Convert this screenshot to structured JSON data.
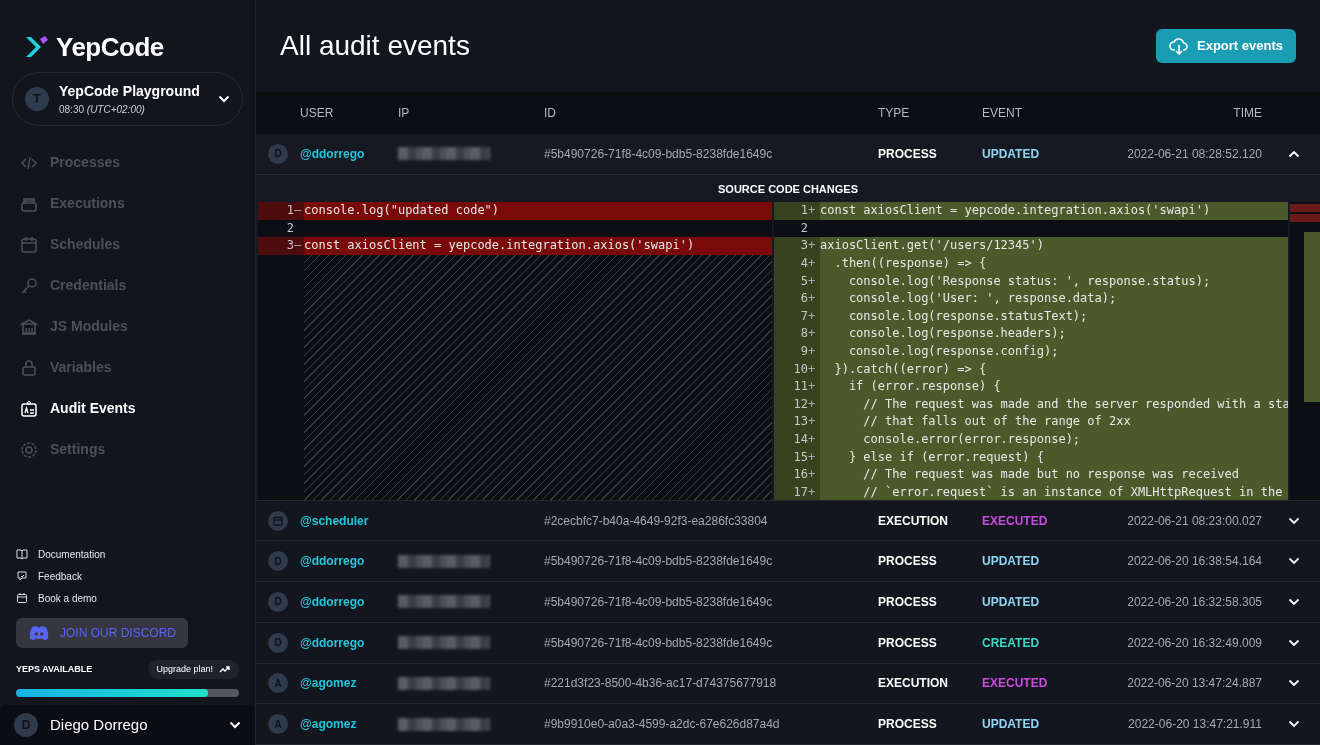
{
  "brand": {
    "name": "YepCode"
  },
  "workspace": {
    "avatar": "T",
    "name": "YepCode Playground",
    "time": "08:30",
    "timezone": "(UTC+02:00)"
  },
  "nav": [
    {
      "label": "Processes",
      "selected": false
    },
    {
      "label": "Executions",
      "selected": false
    },
    {
      "label": "Schedules",
      "selected": false
    },
    {
      "label": "Credentials",
      "selected": false
    },
    {
      "label": "JS Modules",
      "selected": false
    },
    {
      "label": "Variables",
      "selected": false
    },
    {
      "label": "Audit Events",
      "selected": true
    },
    {
      "label": "Settings",
      "selected": false
    }
  ],
  "links": [
    {
      "label": "Documentation"
    },
    {
      "label": "Feedback"
    },
    {
      "label": "Book a demo"
    }
  ],
  "discord": {
    "label": "JOIN OUR DISCORD"
  },
  "yeps": {
    "label": "YEPS AVAILABLE",
    "upgrade": "Upgrade plan!",
    "level": 0.86
  },
  "user": {
    "avatar": "D",
    "name": "Diego Dorrego"
  },
  "page": {
    "title": "All audit events",
    "export_button": "Export events"
  },
  "table": {
    "columns": [
      "USER",
      "IP",
      "ID",
      "TYPE",
      "EVENT",
      "TIME"
    ],
    "rows": [
      {
        "avatar": "D",
        "user": "@ddorrego",
        "ip_redacted": true,
        "id": "#5b490726-71f8-4c09-bdb5-8238fde1649c",
        "type": "PROCESS",
        "event": "UPDATED",
        "color": "#8fd6f5",
        "time": "2022-06-21 08:28:52.120",
        "expanded": true
      },
      {
        "user": "@scheduler",
        "ip_redacted": false,
        "id": "#2cecbfc7-b40a-4649-92f3-ea286fc33804",
        "type": "EXECUTION",
        "event": "EXECUTED",
        "color": "#c94ce0",
        "time": "2022-06-21 08:23:00.027",
        "expanded": false
      },
      {
        "avatar": "D",
        "user": "@ddorrego",
        "ip_redacted": true,
        "id": "#5b490726-71f8-4c09-bdb5-8238fde1649c",
        "type": "PROCESS",
        "event": "UPDATED",
        "color": "#8fd6f5",
        "time": "2022-06-20 16:38:54.164",
        "expanded": false
      },
      {
        "avatar": "D",
        "user": "@ddorrego",
        "ip_redacted": true,
        "id": "#5b490726-71f8-4c09-bdb5-8238fde1649c",
        "type": "PROCESS",
        "event": "UPDATED",
        "color": "#8fd6f5",
        "time": "2022-06-20 16:32:58.305",
        "expanded": false
      },
      {
        "avatar": "D",
        "user": "@ddorrego",
        "ip_redacted": true,
        "id": "#5b490726-71f8-4c09-bdb5-8238fde1649c",
        "type": "PROCESS",
        "event": "CREATED",
        "color": "#3dd6c0",
        "time": "2022-06-20 16:32:49.009",
        "expanded": false
      },
      {
        "avatar": "A",
        "user": "@agomez",
        "ip_redacted": true,
        "id": "#221d3f23-8500-4b36-ac17-d74375677918",
        "type": "EXECUTION",
        "event": "EXECUTED",
        "color": "#c94ce0",
        "time": "2022-06-20 13:47:24.887",
        "expanded": false
      },
      {
        "avatar": "A",
        "user": "@agomez",
        "ip_redacted": true,
        "id": "#9b9910e0-a0a3-4599-a2dc-67e626d87a4d",
        "type": "PROCESS",
        "event": "UPDATED",
        "color": "#8fd6f5",
        "time": "2022-06-20 13:47:21.911",
        "expanded": false
      }
    ]
  },
  "diff": {
    "title": "SOURCE CODE CHANGES",
    "left": [
      {
        "kind": "removed",
        "number": "1",
        "marker": "—",
        "code": "console.log(\"updated code\")"
      },
      {
        "kind": "context",
        "number": "2"
      },
      {
        "kind": "removed",
        "number": "3",
        "marker": "—",
        "code": "const axiosClient = yepcode.integration.axios('swapi')"
      }
    ],
    "right": [
      {
        "kind": "added",
        "number": "1",
        "marker": "+",
        "code": "const axiosClient = yepcode.integration.axios('swapi')"
      },
      {
        "kind": "context",
        "number": "2"
      },
      {
        "kind": "added",
        "number": "3",
        "marker": "+",
        "code": "axiosClient.get('/users/12345')"
      },
      {
        "kind": "added",
        "number": "4",
        "marker": "+",
        "code": "  .then((response) => {"
      },
      {
        "kind": "added",
        "number": "5",
        "marker": "+",
        "code": "    console.log('Response status: ', response.status);"
      },
      {
        "kind": "added",
        "number": "6",
        "marker": "+",
        "code": "    console.log('User: ', response.data);"
      },
      {
        "kind": "added",
        "number": "7",
        "marker": "+",
        "code": "    console.log(response.statusText);"
      },
      {
        "kind": "added",
        "number": "8",
        "marker": "+",
        "code": "    console.log(response.headers);"
      },
      {
        "kind": "added",
        "number": "9",
        "marker": "+",
        "code": "    console.log(response.config);"
      },
      {
        "kind": "added",
        "number": "10",
        "marker": "+",
        "code": "  }).catch((error) => {"
      },
      {
        "kind": "added",
        "number": "11",
        "marker": "+",
        "code": "    if (error.response) {"
      },
      {
        "kind": "added",
        "number": "12",
        "marker": "+",
        "code": "      // The request was made and the server responded with a sta"
      },
      {
        "kind": "added",
        "number": "13",
        "marker": "+",
        "code": "      // that falls out of the range of 2xx"
      },
      {
        "kind": "added",
        "number": "14",
        "marker": "+",
        "code": "      console.error(error.response);"
      },
      {
        "kind": "added",
        "number": "15",
        "marker": "+",
        "code": "    } else if (error.request) {"
      },
      {
        "kind": "added",
        "number": "16",
        "marker": "+",
        "code": "      // The request was made but no response was received"
      },
      {
        "kind": "added",
        "number": "17",
        "marker": "+",
        "code": "      // `error.request` is an instance of XMLHttpRequest in the"
      }
    ]
  }
}
